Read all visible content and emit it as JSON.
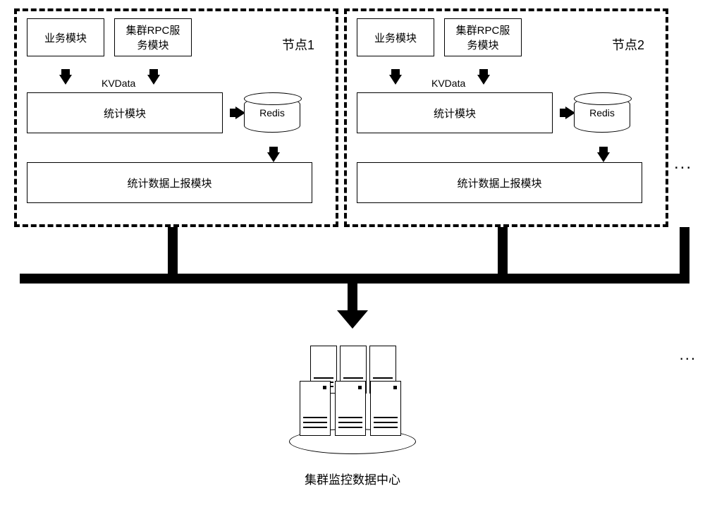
{
  "nodes": [
    {
      "title": "节点1",
      "biz_module": "业务模块",
      "rpc_module": "集群RPC服\n务模块",
      "kvdata": "KVData",
      "stats_module": "统计模块",
      "redis": "Redis",
      "report_module": "统计数据上报模块"
    },
    {
      "title": "节点2",
      "biz_module": "业务模块",
      "rpc_module": "集群RPC服\n务模块",
      "kvdata": "KVData",
      "stats_module": "统计模块",
      "redis": "Redis",
      "report_module": "统计数据上报模块"
    }
  ],
  "ellipsis": "...",
  "datacenter_label": "集群监控数据中心"
}
